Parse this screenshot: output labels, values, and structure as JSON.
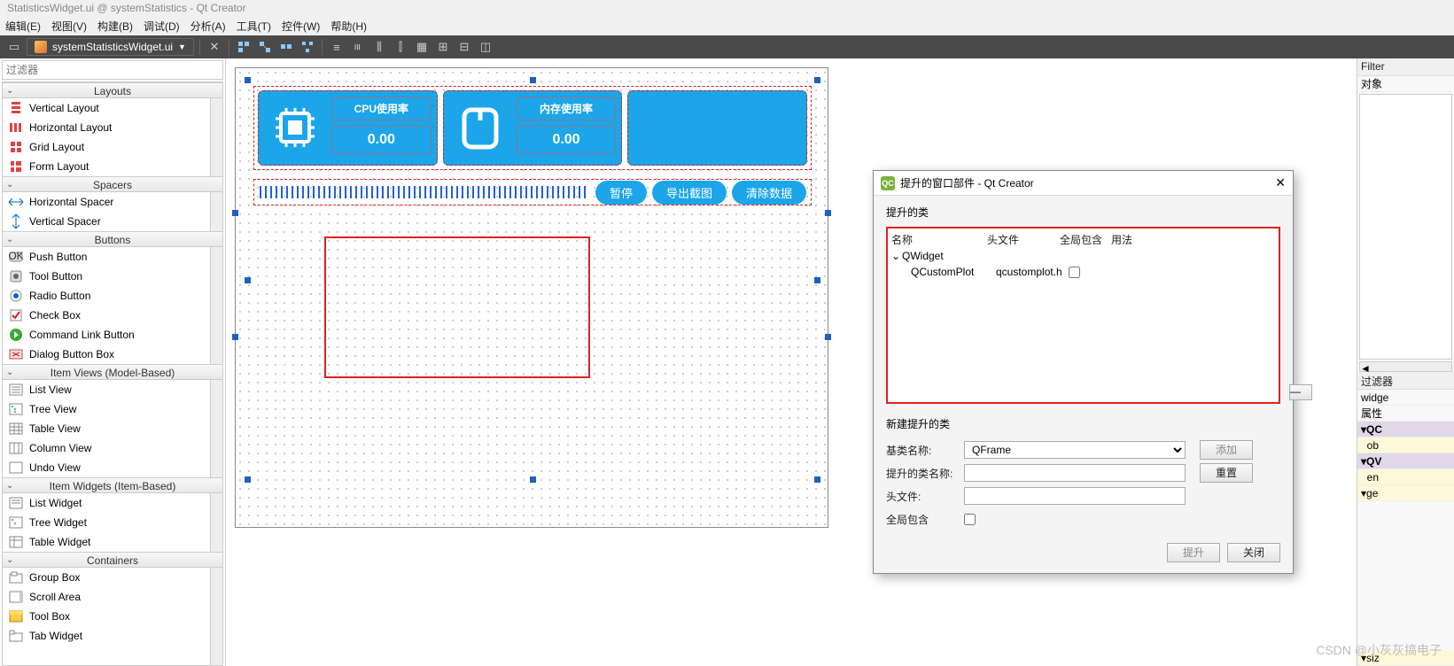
{
  "title_hint": "StatisticsWidget.ui @ systemStatistics - Qt Creator",
  "menus": [
    "编辑(E)",
    "视图(V)",
    "构建(B)",
    "调试(D)",
    "分析(A)",
    "工具(T)",
    "控件(W)",
    "帮助(H)"
  ],
  "open_file": "systemStatisticsWidget.ui",
  "filter_placeholder": "过滤器",
  "sections": {
    "layouts": {
      "title": "Layouts",
      "items": [
        "Vertical Layout",
        "Horizontal Layout",
        "Grid Layout",
        "Form Layout"
      ]
    },
    "spacers": {
      "title": "Spacers",
      "items": [
        "Horizontal Spacer",
        "Vertical Spacer"
      ]
    },
    "buttons": {
      "title": "Buttons",
      "items": [
        "Push Button",
        "Tool Button",
        "Radio Button",
        "Check Box",
        "Command Link Button",
        "Dialog Button Box"
      ]
    },
    "itemviews": {
      "title": "Item Views (Model-Based)",
      "items": [
        "List View",
        "Tree View",
        "Table View",
        "Column View",
        "Undo View"
      ]
    },
    "itemwidgets": {
      "title": "Item Widgets (Item-Based)",
      "items": [
        "List Widget",
        "Tree Widget",
        "Table Widget"
      ]
    },
    "containers": {
      "title": "Containers",
      "items": [
        "Group Box",
        "Scroll Area",
        "Tool Box",
        "Tab Widget"
      ]
    }
  },
  "cards": {
    "cpu": {
      "label": "CPU使用率",
      "value": "0.00"
    },
    "mem": {
      "label": "内存使用率",
      "value": "0.00"
    }
  },
  "action_buttons": {
    "pause": "暂停",
    "export": "导出截图",
    "clear": "清除数据"
  },
  "dialog": {
    "title": "提升的窗口部件 - Qt Creator",
    "close": "✕",
    "section_promoted": "提升的类",
    "columns": {
      "name": "名称",
      "header": "头文件",
      "global": "全局包含",
      "usage": "用法"
    },
    "tree_parent": "QWidget",
    "tree_child_name": "QCustomPlot",
    "tree_child_header": "qcustomplot.h",
    "section_new": "新建提升的类",
    "base_label": "基类名称:",
    "base_value": "QFrame",
    "promoted_label": "提升的类名称:",
    "headerfile_label": "头文件:",
    "global_label": "全局包含",
    "add_btn": "添加",
    "reset_btn": "重置",
    "promote_btn": "提升",
    "close_btn": "关闭"
  },
  "right_panel": {
    "filter": "Filter",
    "object": "对象",
    "filter2": "过滤器",
    "widget": "widge",
    "prop": "属性",
    "qc": "QC",
    "ob": "ob",
    "qw": "QV",
    "en": "en",
    "ge": "ge",
    "siz": "siz"
  },
  "watermark": "CSDN @小灰灰搞电子"
}
